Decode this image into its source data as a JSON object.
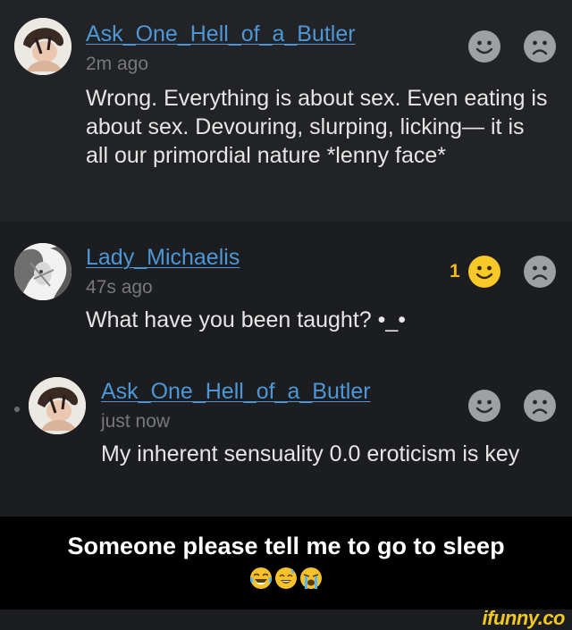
{
  "comments": [
    {
      "username": "Ask_One_Hell_of_a_Butler",
      "time": "2m ago",
      "text": "Wrong. Everything is about sex. Even eating is about sex. Devouring, slurping, licking— it is all our primordial nature *lenny face*",
      "smile_count": ""
    },
    {
      "username": "Lady_Michaelis",
      "time": "47s ago",
      "text": "What have you been taught? •_•",
      "smile_count": "1"
    },
    {
      "username": "Ask_One_Hell_of_a_Butler",
      "time": "just now",
      "text": "My inherent sensuality 0.0 eroticism is key",
      "smile_count": ""
    }
  ],
  "icons": {
    "smile": "smile-icon",
    "frown": "frown-icon",
    "active_smile_color": "#f8c928",
    "inactive_face_color": "#9fa0a3",
    "username_color": "#4d97d6"
  },
  "caption": {
    "text": "Someone please tell me to go to sleep",
    "emojis": [
      "crying-laughing-emoji",
      "sweat-smile-emoji",
      "loudly-crying-emoji"
    ]
  },
  "watermark": {
    "text": "ifunny.co"
  }
}
